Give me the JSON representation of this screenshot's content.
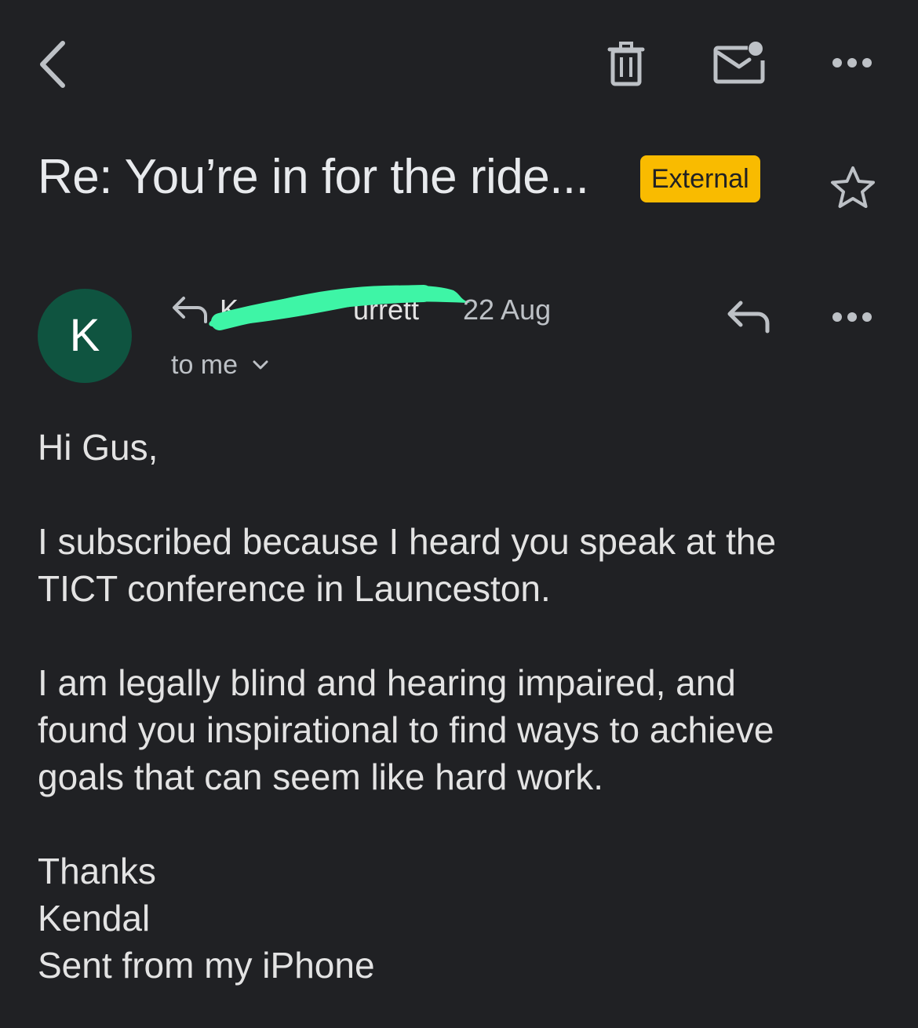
{
  "icons": {
    "back": "chevron-left-icon",
    "delete": "trash-icon",
    "mark_unread": "mail-unread-icon",
    "more": "more-horizontal-icon",
    "star": "star-outline-icon",
    "reply": "reply-icon",
    "replied": "replied-arrow-icon",
    "expand": "chevron-down-icon"
  },
  "colors": {
    "background": "#202124",
    "badge": "#f9bb00",
    "avatar": "#0f5440",
    "redaction": "#3ef5a6"
  },
  "subject": "Re: You’re in for the ride...",
  "badge": "External",
  "message": {
    "avatar_letter": "K",
    "sender_visible_start": "K",
    "sender_visible_end": "urrett",
    "date": "22 Aug",
    "recipient": "to me"
  },
  "body": {
    "greeting": "Hi Gus,",
    "p1_l1": "I subscribed because I heard you speak at the",
    "p1_l2": "TICT conference in Launceston.",
    "p2_l1": "I am legally blind and hearing impaired, and",
    "p2_l2": "found you inspirational to find ways to achieve",
    "p2_l3": "goals that can seem like hard work.",
    "sig_l1": "Thanks",
    "sig_l2": "Kendal",
    "sig_l3": "Sent from my iPhone"
  }
}
